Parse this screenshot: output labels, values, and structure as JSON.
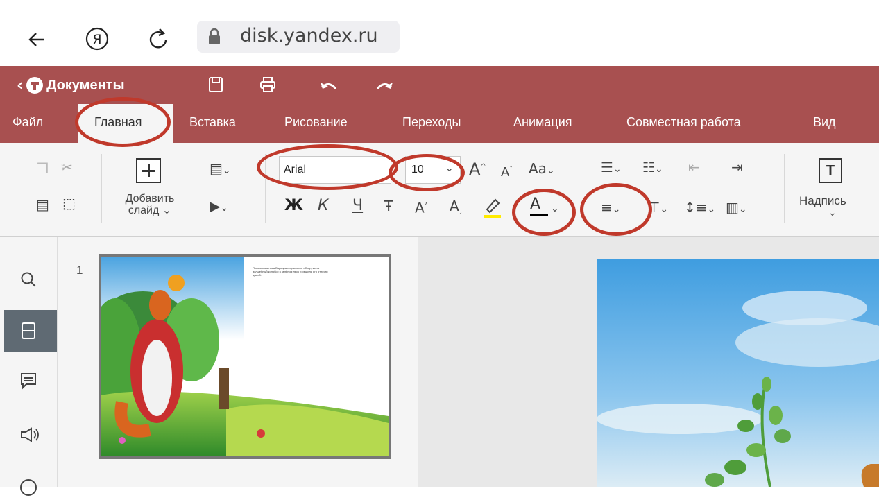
{
  "browser": {
    "back_icon": "arrow-left-icon",
    "yandex_icon": "yandex-logo-icon",
    "reload_icon": "reload-icon",
    "lock_icon": "lock-icon",
    "url": "disk.yandex.ru"
  },
  "titlebar": {
    "back_label": "Документы",
    "icons": [
      "save-icon",
      "print-icon",
      "undo-icon",
      "redo-icon"
    ],
    "color": "#a85050"
  },
  "tabs": [
    {
      "label": "Файл"
    },
    {
      "label": "Главная",
      "active": true
    },
    {
      "label": "Вставка"
    },
    {
      "label": "Рисование"
    },
    {
      "label": "Переходы"
    },
    {
      "label": "Анимация"
    },
    {
      "label": "Совместная работа"
    },
    {
      "label": "Вид"
    }
  ],
  "ribbon": {
    "add_slide_label": "Добавить",
    "add_slide_label2": "слайд",
    "font_name": "Arial",
    "font_size": "10",
    "font_grow": "A",
    "font_shrink": "A",
    "change_case": "Aa",
    "bold": "Ж",
    "italic": "К",
    "underline": "Ч",
    "strike": "Ŧ",
    "superscript": "A",
    "subscript": "A",
    "font_color_letter": "A",
    "textbox_label": "Надпись",
    "highlight_color": "#ffeb00",
    "font_color": "#000000"
  },
  "slides_panel": {
    "slide_number": "1",
    "slide_text": "Прекрасная лиса Варвара на рассвете обнаружила волшебный колобок в зелёном лесу и решила его отнести домой."
  },
  "annotation_color": "#c0392b"
}
